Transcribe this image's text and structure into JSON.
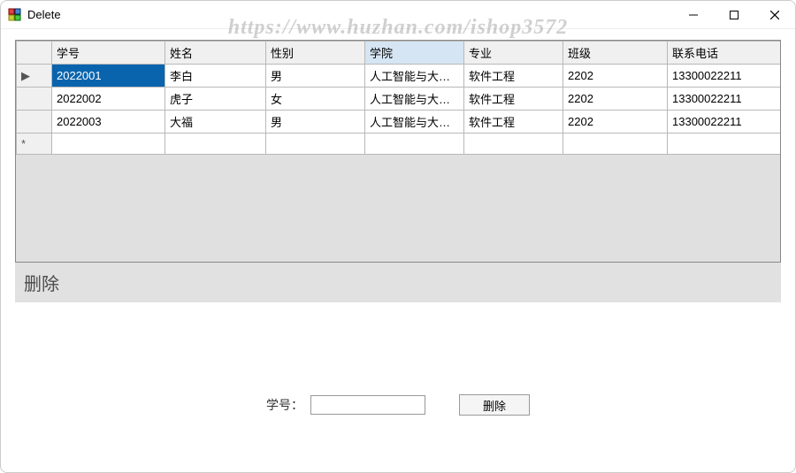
{
  "window": {
    "title": "Delete"
  },
  "grid": {
    "columns": [
      "学号",
      "姓名",
      "性别",
      "学院",
      "专业",
      "班级",
      "联系电话"
    ],
    "sorted_column_index": 3,
    "rows": [
      {
        "selected": true,
        "marker": "▶",
        "cells": [
          "2022001",
          "李白",
          "男",
          "人工智能与大…",
          "软件工程",
          "2202",
          "13300022211"
        ]
      },
      {
        "selected": false,
        "marker": "",
        "cells": [
          "2022002",
          "虎子",
          "女",
          "人工智能与大…",
          "软件工程",
          "2202",
          "13300022211"
        ]
      },
      {
        "selected": false,
        "marker": "",
        "cells": [
          "2022003",
          "大福",
          "男",
          "人工智能与大…",
          "软件工程",
          "2202",
          "13300022211"
        ]
      },
      {
        "selected": false,
        "marker": "*",
        "cells": [
          "",
          "",
          "",
          "",
          "",
          "",
          ""
        ]
      }
    ]
  },
  "section": {
    "title": "删除"
  },
  "form": {
    "label": "学号：",
    "input_value": "",
    "button": "删除"
  },
  "watermark": "https://www.huzhan.com/ishop3572"
}
